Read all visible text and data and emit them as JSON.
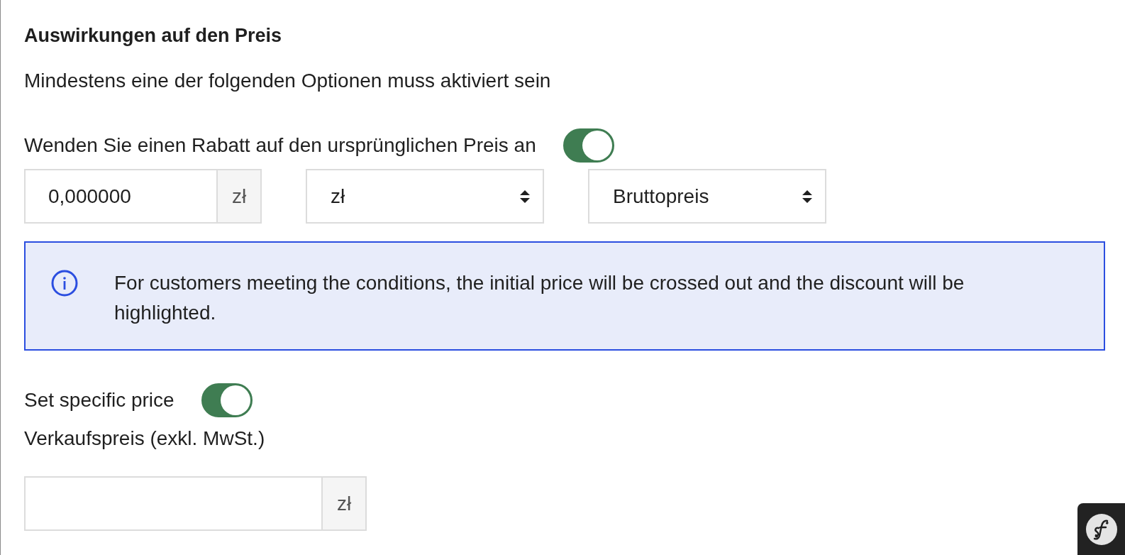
{
  "section": {
    "title": "Auswirkungen auf den Preis",
    "hint": "Mindestens eine der folgenden Optionen muss aktiviert sein"
  },
  "discount": {
    "label": "Wenden Sie einen Rabatt auf den ursprünglichen Preis an",
    "on": true,
    "amount": {
      "value": "0,000000",
      "suffix": "zł"
    },
    "selects": [
      {
        "value": "zł"
      },
      {
        "value": "Bruttopreis"
      }
    ]
  },
  "info": {
    "text": "For customers meeting the conditions, the initial price will be crossed out and the discount will be highlighted."
  },
  "specific_price": {
    "label": "Set specific price",
    "on": true,
    "field_label": "Verkaufspreis (exkl. MwSt.)",
    "field": {
      "suffix": "zł"
    }
  }
}
